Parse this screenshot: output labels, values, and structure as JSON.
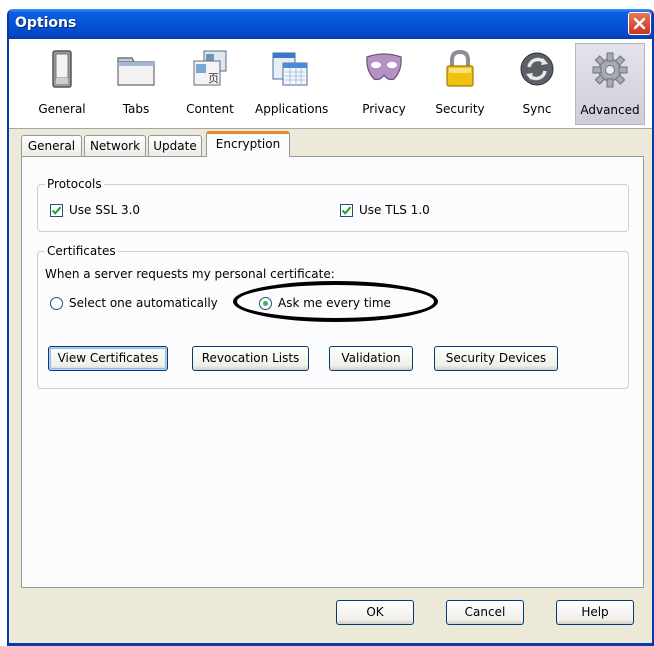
{
  "window": {
    "title": "Options"
  },
  "panes": [
    {
      "label": "General"
    },
    {
      "label": "Tabs"
    },
    {
      "label": "Content"
    },
    {
      "label": "Applications"
    },
    {
      "label": "Privacy"
    },
    {
      "label": "Security"
    },
    {
      "label": "Sync"
    },
    {
      "label": "Advanced",
      "selected": true
    }
  ],
  "tabs": [
    {
      "label": "General"
    },
    {
      "label": "Network"
    },
    {
      "label": "Update"
    },
    {
      "label": "Encryption",
      "active": true
    }
  ],
  "protocols": {
    "legend": "Protocols",
    "ssl": {
      "label": "Use SSL 3.0",
      "checked": true
    },
    "tls": {
      "label": "Use TLS 1.0",
      "checked": true
    }
  },
  "certificates": {
    "legend": "Certificates",
    "prompt": "When a server requests my personal certificate:",
    "auto": {
      "label": "Select one automatically",
      "selected": false
    },
    "ask": {
      "label": "Ask me every time",
      "selected": true
    },
    "view_label": "View Certificates",
    "revocation_label": "Revocation Lists",
    "validation_label": "Validation",
    "devices_label": "Security Devices"
  },
  "footer": {
    "ok_label": "OK",
    "cancel_label": "Cancel",
    "help_label": "Help"
  },
  "colors": {
    "titlebar": "#0654d8",
    "dialog_bg": "#ece9d8",
    "active_tab_accent": "#e68b2c",
    "check_color": "#21a121",
    "radio_dot": "#3fb54e"
  }
}
